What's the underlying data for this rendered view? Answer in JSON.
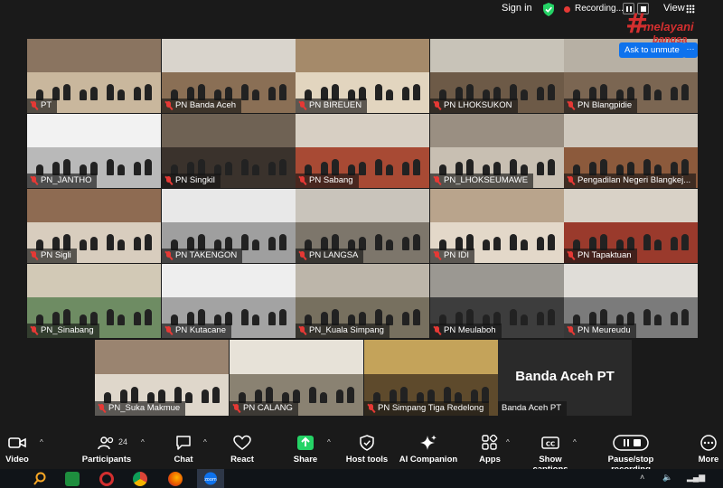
{
  "topbar": {
    "signin": "Sign in",
    "recording": "Recording...",
    "view": "View"
  },
  "watermark": {
    "mark": "#",
    "line1": "melayani",
    "line2": "bangsa"
  },
  "popover": {
    "unmute": "Ask to unmute",
    "more": "···"
  },
  "tiles": [
    "PT",
    "PN Banda Aceh",
    "PN BIREUEN",
    "PN LHOKSUKON",
    "PN Blangpidie",
    "PN_JANTHO",
    "PN Singkil",
    "PN Sabang",
    "PN_LHOKSEUMAWE",
    "Pengadilan Negeri Blangkej...",
    "PN Sigli",
    "PN TAKENGON",
    "PN LANGSA",
    "PN IDI",
    "PN Tapaktuan",
    "PN_Sinabang",
    "PN Kutacane",
    "PN_Kuala Simpang",
    "PN Meulaboh",
    "PN Meureudu",
    "PN_Suka Makmue",
    "PN CALANG",
    "PN Simpang Tiga Redelong",
    "Banda Aceh PT"
  ],
  "name_tile": {
    "big_name": "Banda Aceh PT"
  },
  "toolbar": {
    "video": "Video",
    "participants": "Participants",
    "participants_count": "24",
    "chat": "Chat",
    "react": "React",
    "share": "Share",
    "host_tools": "Host tools",
    "ai_companion": "AI Companion",
    "apps": "Apps",
    "captions": "Show captions",
    "recording": "Pause/stop recording",
    "more": "More"
  },
  "colors": {
    "accent": "#0e72ed",
    "share": "#25d366",
    "muted": "#e53935",
    "active_speaker": "#25d366"
  }
}
